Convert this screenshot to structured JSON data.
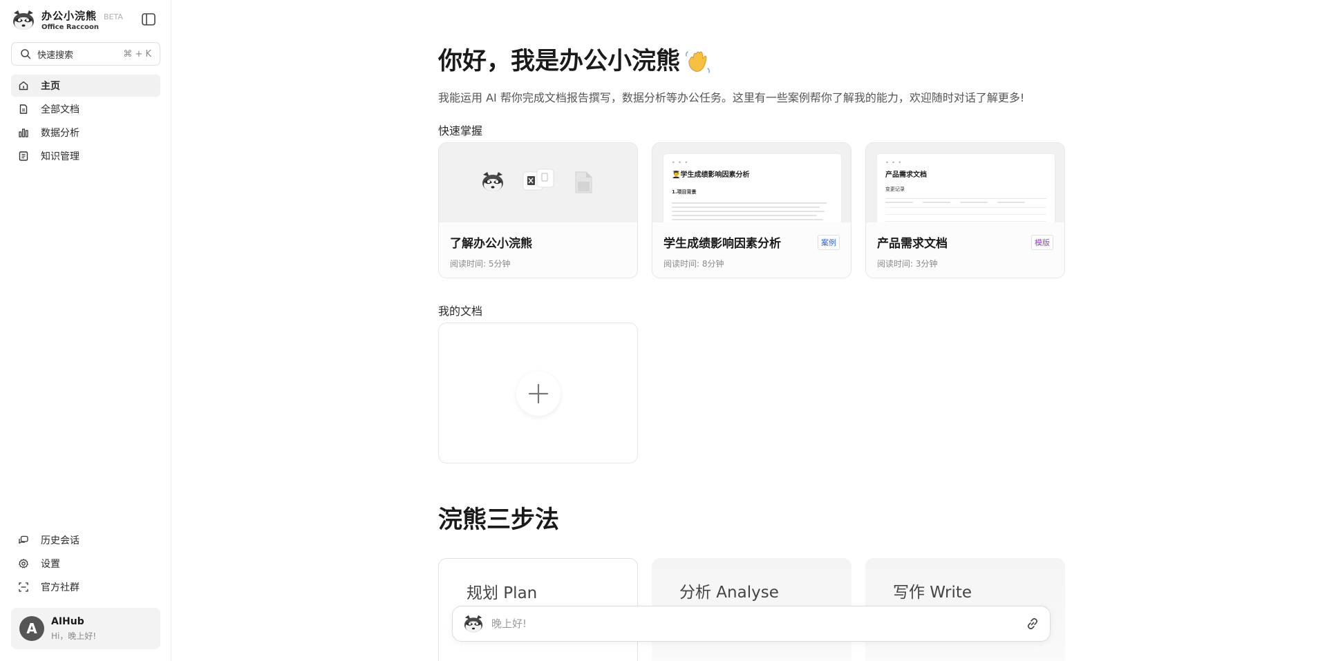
{
  "sidebar": {
    "brand_name": "办公小浣熊",
    "brand_beta": "BETA",
    "brand_sub": "Office Raccoon",
    "search_placeholder": "快速搜索",
    "search_shortcut": "⌘ + K",
    "nav_items": [
      {
        "label": "主页",
        "icon": "home-icon",
        "active": true
      },
      {
        "label": "全部文档",
        "icon": "document-icon"
      },
      {
        "label": "数据分析",
        "icon": "bar-chart-icon"
      },
      {
        "label": "知识管理",
        "icon": "notebook-icon"
      }
    ],
    "bottom_items": [
      {
        "label": "历史会话",
        "icon": "chat-history-icon"
      },
      {
        "label": "设置",
        "icon": "gear-icon"
      },
      {
        "label": "官方社群",
        "icon": "community-icon"
      }
    ],
    "user": {
      "avatar_letter": "A",
      "name": "AIHub",
      "greeting": "Hi，晚上好!"
    }
  },
  "main": {
    "hello": "你好，我是办公小浣熊",
    "intro": "我能运用 AI 帮你完成文档报告撰写，数据分析等办公任务。这里有一些案例帮你了解我的能力，欢迎随时对话了解更多!",
    "quick_label": "快速掌握",
    "cards": [
      {
        "title": "了解办公小浣熊",
        "meta": "阅读时间: 5分钟",
        "badge": ""
      },
      {
        "title": "学生成绩影响因素分析",
        "meta": "阅读时间: 8分钟",
        "badge": "案例",
        "thumb_title": "👨‍🎓学生成绩影响因素分析",
        "thumb_sub": "1.项目背景"
      },
      {
        "title": "产品需求文档",
        "meta": "阅读时间: 3分钟",
        "badge": "模版",
        "thumb_title": "产品需求文档",
        "thumb_sub": "变更记录"
      }
    ],
    "my_docs_label": "我的文档",
    "steps_title": "浣熊三步法",
    "steps": [
      "规划 Plan",
      "分析 Analyse",
      "写作 Write"
    ]
  },
  "chat": {
    "placeholder": "晚上好!"
  },
  "colors": {
    "accent_case": "#2b5fd9",
    "accent_template": "#9b3fd6",
    "active_nav": "#f1f1f1"
  }
}
